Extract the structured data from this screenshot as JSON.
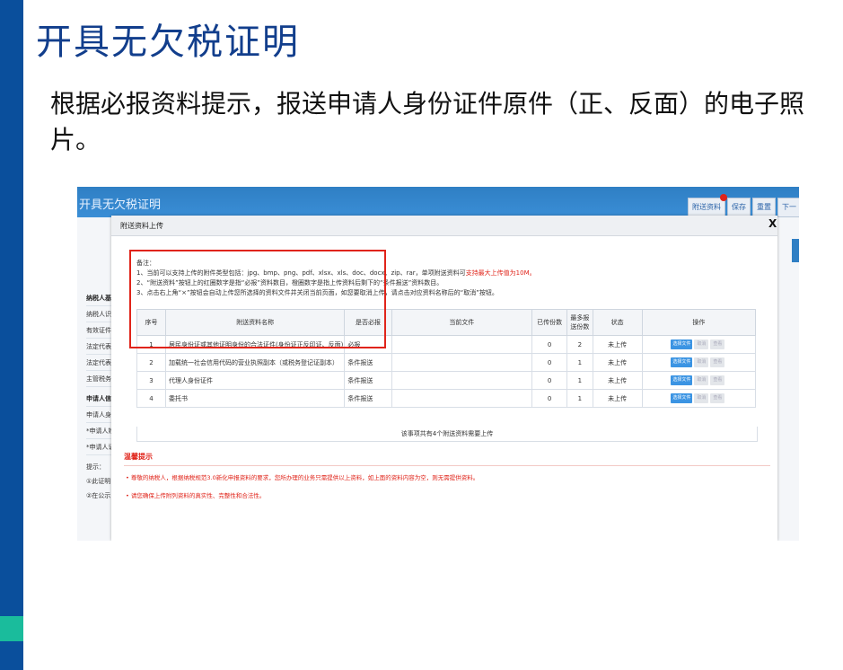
{
  "slide": {
    "title": "开具无欠税证明",
    "body": "根据必报资料提示，报送申请人身份证件原件（正、反面）的电子照片。"
  },
  "app": {
    "title": "开具无欠税证明",
    "top_buttons": [
      "附送资料",
      "保存",
      "重置",
      "下一"
    ]
  },
  "background_form": {
    "rows": [
      "纳税人基",
      "纳税人识",
      "有效证件",
      "法定代表",
      "法定代表",
      "主管税务",
      "申请人信",
      "申请人身",
      "*申请人姓",
      "*申请人证"
    ],
    "hint_label": "提示：",
    "hint_lines": [
      "①此证明",
      "②在公示"
    ]
  },
  "modal": {
    "title": "附送资料上传",
    "close": "X",
    "notes_label": "备注：",
    "notes": [
      {
        "text": "1、当前可以支持上传的附件类型包括：jpg、bmp、png、pdf、xlsx、xls、doc、docx、zip、rar，单项附送资料可",
        "red": "支持最大上传值为10M。"
      },
      {
        "text": "2、“附送资料”按钮上的红圈数字是指“必报”资料数目，橙圈数字是指上传资料后剩下的“条件报送”资料数目。",
        "red": ""
      },
      {
        "text": "3、点击右上角“×”按钮会自动上传您所选择的资料文件并关闭当前页面，如您要取消上传，请点击对应资料名称后的“取消”按钮。",
        "red": ""
      }
    ],
    "table": {
      "headers": [
        "序号",
        "附送资料名称",
        "是否必报",
        "当前文件",
        "已传份数",
        "最多报送份数",
        "状态",
        "操作"
      ],
      "rows": [
        {
          "no": "1",
          "name": "居民身份证或其他证明身份的合法证件(身份证正反印证、反面)",
          "required": "必报",
          "file": "",
          "uploaded": "0",
          "max": "2",
          "status": "未上传"
        },
        {
          "no": "2",
          "name": "加载统一社会信用代码的营业执照副本（或税务登记证副本）",
          "required": "条件报送",
          "file": "",
          "uploaded": "0",
          "max": "1",
          "status": "未上传"
        },
        {
          "no": "3",
          "name": "代理人身份证件",
          "required": "条件报送",
          "file": "",
          "uploaded": "0",
          "max": "1",
          "status": "未上传"
        },
        {
          "no": "4",
          "name": "委托书",
          "required": "条件报送",
          "file": "",
          "uploaded": "0",
          "max": "1",
          "status": "未上传"
        }
      ],
      "actions": {
        "select": "选择文件",
        "cancel": "取消",
        "view": "查看"
      },
      "summary": "该事项共有4个附送资料需要上传"
    },
    "tips_title": "温馨提示",
    "tips": [
      "• 尊敬的纳税人，根据纳税规范3.0新化申报资料的要求，您所办理的业务只需提供以上资料，如上面的资料内容为空，则无需提供资料。",
      "• 请您确保上传附列资料的真实性、完整性和合法性。"
    ]
  },
  "colors": {
    "slide_bar": "#0a4f9c",
    "accent": "#1abc9c",
    "title": "#123e8c",
    "header": "#2f7fc4",
    "alert": "#e0241a"
  }
}
